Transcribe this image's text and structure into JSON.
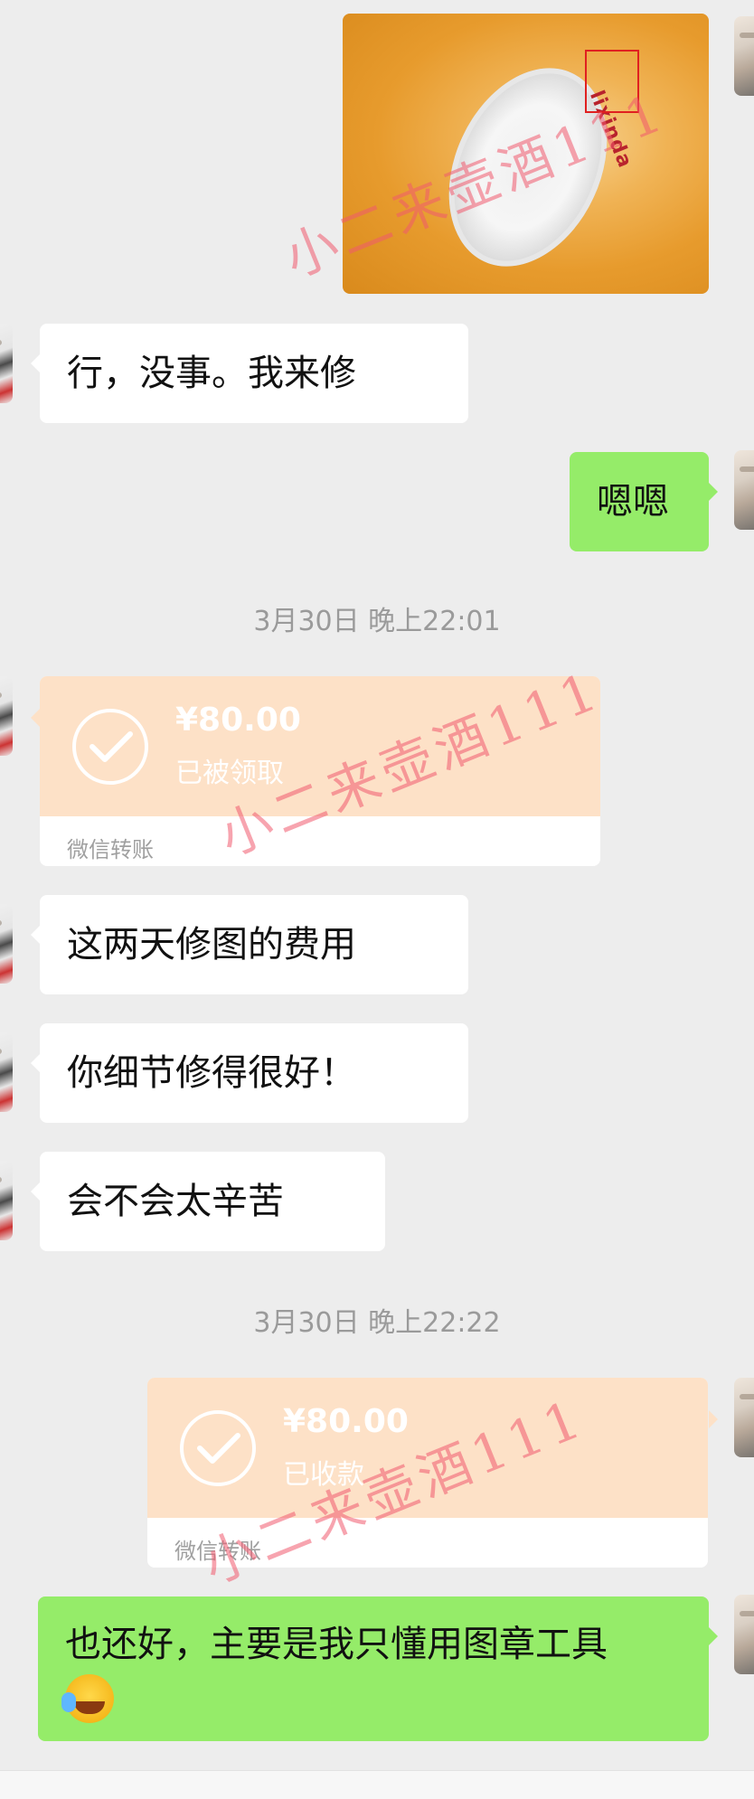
{
  "messages": {
    "msg1": "行，没事。我来修",
    "msg2": "嗯嗯",
    "msg3": "这两天修图的费用",
    "msg4": "你细节修得很好！",
    "msg5": "会不会太辛苦",
    "msg6": "也还好，主要是我只懂用图章工具"
  },
  "timestamps": {
    "t1": "3月30日 晚上22:01",
    "t2": "3月30日 晚上22:22"
  },
  "transfers": {
    "received": {
      "amount": "¥80.00",
      "status": "已被领取",
      "label": "微信转账"
    },
    "sent": {
      "amount": "¥80.00",
      "status": "已收款",
      "label": "微信转账"
    }
  },
  "watermark": "小二来壶酒111",
  "photo_brand": "lixinda",
  "icons": {
    "transfer_check": "check-circle-icon",
    "emoji": "crying-face-emoji"
  },
  "colors": {
    "background": "#ededed",
    "green_bubble": "#95ec69",
    "transfer_card": "#fde1c7",
    "watermark": "#f05a6e"
  }
}
